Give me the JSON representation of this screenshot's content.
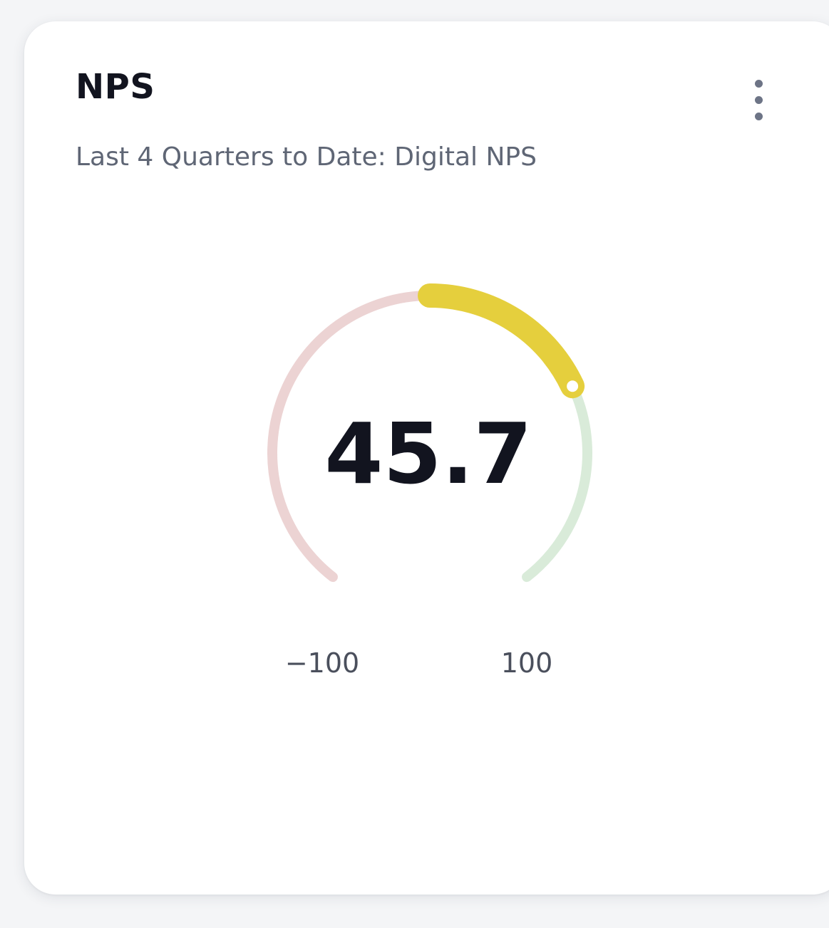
{
  "card": {
    "title": "NPS",
    "subtitle": "Last 4 Quarters to Date: Digital NPS",
    "menu_icon": "more-vertical-icon"
  },
  "gauge": {
    "value": 45.7,
    "value_label": "45.7",
    "min": -100,
    "max": 100,
    "min_label": "−100",
    "max_label": "100",
    "colors": {
      "negative_track": "#ecd3d3",
      "positive_track": "#d9ebd9",
      "value_arc": "#e5cf3d",
      "marker_fill": "#ffffff"
    }
  }
}
